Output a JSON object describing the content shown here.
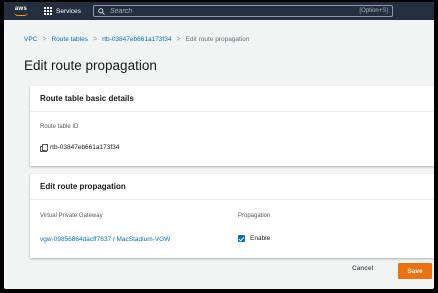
{
  "topbar": {
    "logo_text": "aws",
    "services_label": "Services",
    "search_placeholder": "Search",
    "search_shortcut": "[Option+S]"
  },
  "breadcrumb": {
    "items": [
      "VPC",
      "Route tables",
      "rtb-03847eb661a173f34"
    ],
    "current": "Edit route propagation",
    "separator": ">"
  },
  "page_title": "Edit route propagation",
  "details": {
    "header": "Route table basic details",
    "id_label": "Route table ID",
    "id_value": "rtb-03847eb661a173f34"
  },
  "propagation": {
    "header": "Edit route propagation",
    "col_vgw": "Virtual Private Gateway",
    "col_propagation": "Propagation",
    "vgw_value": "vgw-09856864dacff7837 / MacStadium-VGW",
    "enable_label": "Enable",
    "enabled": true
  },
  "actions": {
    "cancel": "Cancel",
    "save": "Save"
  },
  "colors": {
    "topbar": "#232f3e",
    "link": "#0073bb",
    "primary_button": "#ec7211",
    "page_bg": "#f2f3f3"
  }
}
